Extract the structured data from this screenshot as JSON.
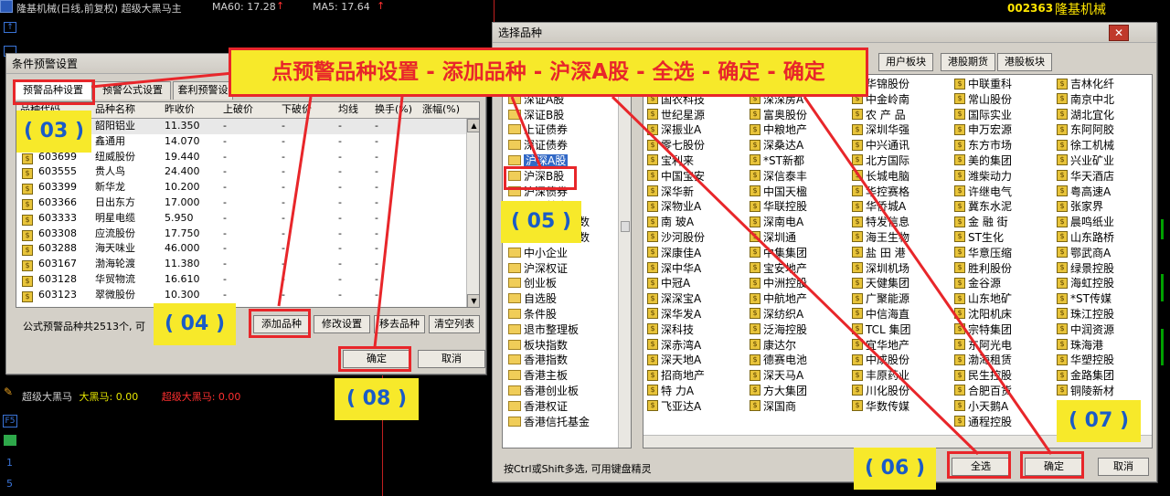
{
  "topbar": {
    "stock_title": "隆基机械(日线,前复权) 超级大黑马主",
    "ma60": "MA60: 17.28",
    "ma5": "MA5: 17.64",
    "code": "002363",
    "name": "隆基机械"
  },
  "indicator_line": {
    "name": "超级大黑马",
    "da_hei_ma": "大黑马: 0.00",
    "super_da_hei_ma": "超级大黑马: 0.00"
  },
  "left_toolbar": [
    "F5",
    "1",
    "5"
  ],
  "banner": "点预警品种设置 - 添加品种 - 沪深A股 - 全选 - 确定 - 确定",
  "callouts": {
    "c03": "( 03 )",
    "c04": "( 04 )",
    "c05": "( 05 )",
    "c06": "( 06 )",
    "c07": "( 07 )",
    "c08": "( 08 )"
  },
  "alert_dialog": {
    "title": "条件预警设置",
    "tabs": [
      "预警品种设置",
      "预警公式设置",
      "套利预警设"
    ],
    "columns": [
      "品种代码",
      "品种名称",
      "昨收价",
      "上破价",
      "下破价",
      "均线",
      "换手(%)",
      "涨幅(%)"
    ],
    "rows": [
      {
        "code": "",
        "name": "韶阳铝业",
        "prev": "11.350",
        "up": "-",
        "down": "-",
        "ma": "-",
        "turn": "-"
      },
      {
        "code": "",
        "name": "鑫通用",
        "prev": "14.070",
        "up": "-",
        "down": "-",
        "ma": "-",
        "turn": "-"
      },
      {
        "code": "603699",
        "name": "纽威股份",
        "prev": "19.440",
        "up": "-",
        "down": "-",
        "ma": "-",
        "turn": "-"
      },
      {
        "code": "603555",
        "name": "贵人鸟",
        "prev": "24.400",
        "up": "-",
        "down": "-",
        "ma": "-",
        "turn": "-"
      },
      {
        "code": "603399",
        "name": "新华龙",
        "prev": "10.200",
        "up": "-",
        "down": "-",
        "ma": "-",
        "turn": "-"
      },
      {
        "code": "603366",
        "name": "日出东方",
        "prev": "17.000",
        "up": "-",
        "down": "-",
        "ma": "-",
        "turn": "-"
      },
      {
        "code": "603333",
        "name": "明星电缆",
        "prev": "5.950",
        "up": "-",
        "down": "-",
        "ma": "-",
        "turn": "-"
      },
      {
        "code": "603308",
        "name": "应流股份",
        "prev": "17.750",
        "up": "-",
        "down": "-",
        "ma": "-",
        "turn": "-"
      },
      {
        "code": "603288",
        "name": "海天味业",
        "prev": "46.000",
        "up": "-",
        "down": "-",
        "ma": "-",
        "turn": "-"
      },
      {
        "code": "603167",
        "name": "渤海轮渡",
        "prev": "11.380",
        "up": "-",
        "down": "-",
        "ma": "-",
        "turn": "-"
      },
      {
        "code": "603128",
        "name": "华贸物流",
        "prev": "16.610",
        "up": "-",
        "down": "-",
        "ma": "-",
        "turn": "-"
      },
      {
        "code": "603123",
        "name": "翠微股份",
        "prev": "10.300",
        "up": "-",
        "down": "-",
        "ma": "-",
        "turn": "-"
      }
    ],
    "summary": "公式预警品种共2513个, 可",
    "buttons": {
      "add": "添加品种",
      "modify": "修改设置",
      "remove": "移去品种",
      "clear": "清空列表",
      "ok": "确定",
      "cancel": "取消"
    }
  },
  "select_dialog": {
    "title": "选择品种",
    "tabs": [
      "用户板块",
      "港股期货",
      "港股板块"
    ],
    "tree": [
      "上证B股",
      "深证A股",
      "深证B股",
      "上证债券",
      "深证债券",
      "沪深A股",
      "沪深B股",
      "沪深债券",
      "沪深基金",
      "所有沪深指数",
      "所有沪深指数",
      "中小企业",
      "沪深权证",
      "创业板",
      "自选股",
      "条件股",
      "退市整理板",
      "板块指数",
      "香港指数",
      "香港主板",
      "香港创业板",
      "香港权证",
      "香港信托基金"
    ],
    "tree_selected": "沪深A股",
    "columns": [
      [
        "万 科A",
        "国农科技",
        "世纪星源",
        "深振业A",
        "零七股份",
        "宝利来",
        "中国宝安",
        "深华新",
        "深物业A",
        "南 玻A",
        "沙河股份",
        "深康佳A",
        "深中华A",
        "中冠A",
        "深深宝A",
        "深华发A",
        "深科技",
        "深赤湾A",
        "深天地A",
        "招商地产",
        "特 力A",
        "飞亚达A"
      ],
      [
        "国药一致",
        "深深房A",
        "富奥股份",
        "中粮地产",
        "深桑达A",
        "*ST新都",
        "深信泰丰",
        "中国天楹",
        "华联控股",
        "深南电A",
        "深圳通",
        "中集集团",
        "宝安地产",
        "中洲控股",
        "中航地产",
        "深纺织A",
        "泛海控股",
        "康达尔",
        "德赛电池",
        "深天马A",
        "方大集团",
        "深国商"
      ],
      [
        "华锦股份",
        "中金岭南",
        "农 产 品",
        "深圳华强",
        "中兴通讯",
        "北方国际",
        "长城电脑",
        "华控赛格",
        "华侨城A",
        "特发信息",
        "海王生物",
        "盐 田 港",
        "深圳机场",
        "天健集团",
        "广聚能源",
        "中信海直",
        "TCL 集团",
        "宜华地产",
        "中成股份",
        "丰原药业",
        "川化股份",
        "华数传媒"
      ],
      [
        "中联重科",
        "常山股份",
        "国际实业",
        "申万宏源",
        "东方市场",
        "美的集团",
        "潍柴动力",
        "许继电气",
        "冀东水泥",
        "金 融 街",
        "ST生化",
        "华意压缩",
        "胜利股份",
        "金谷源",
        "山东地矿",
        "沈阳机床",
        "宗特集团",
        "东阿光电",
        "渤海租赁",
        "民生控股",
        "合肥百货",
        "小天鹅A",
        "通程控股"
      ],
      [
        "吉林化纤",
        "南京中北",
        "湖北宜化",
        "东阿阿胶",
        "徐工机械",
        "兴业矿业",
        "华天酒店",
        "粤高速A",
        "张家界",
        "晨鸣纸业",
        "山东路桥",
        "鄂武商A",
        "绿景控股",
        "海虹控股",
        "*ST传媒",
        "珠江控股",
        "中润资源",
        "珠海港",
        "华塑控股",
        "金路集团",
        "铜陵新材",
        "",
        ""
      ]
    ],
    "column0_top": "万 科A",
    "column4_top": "吉林化纤",
    "hint": "按Ctrl或Shift多选, 可用键盘精灵",
    "buttons": {
      "select_all": "全选",
      "ok": "确定",
      "cancel": "取消"
    }
  }
}
